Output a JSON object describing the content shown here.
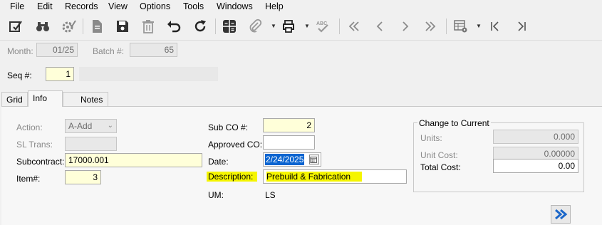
{
  "menu": [
    "File",
    "Edit",
    "Records",
    "View",
    "Options",
    "Tools",
    "Windows",
    "Help"
  ],
  "toolbar": {
    "icons": [
      "edit-check-icon",
      "binoculars-icon",
      "gear-check-icon",
      "document-icon",
      "save-icon",
      "delete-icon",
      "undo-icon",
      "refresh-icon",
      "calculator-icon",
      "attachment-icon",
      "print-icon",
      "spellcheck-icon",
      "first-record-icon",
      "previous-record-icon",
      "next-record-icon",
      "last-record-icon",
      "grid-settings-icon",
      "first-icon",
      "last-icon"
    ]
  },
  "header": {
    "month_label": "Month:",
    "month_value": "01/25",
    "batch_label": "Batch #:",
    "batch_value": "65",
    "seq_label": "Seq #:",
    "seq_value": "1",
    "seq_desc": ""
  },
  "tabs": [
    "Grid",
    "Info",
    "Notes"
  ],
  "info": {
    "action_label": "Action:",
    "action_value": "A-Add",
    "sltrans_label": "SL Trans:",
    "sltrans_value": "",
    "subcontract_label": "Subcontract:",
    "subcontract_value": "17000.001",
    "item_label": "Item#:",
    "item_value": "3",
    "subco_label": "Sub CO #:",
    "subco_value": "2",
    "approved_label": "Approved CO:",
    "approved_value": "",
    "date_label": "Date:",
    "date_value": "2/24/2025",
    "description_label": "Description:",
    "description_value": "Prebuild & Fabrication",
    "um_label": "UM:",
    "um_value": "LS"
  },
  "change_to_current": {
    "title": "Change to Current",
    "units_label": "Units:",
    "units_value": "0.000",
    "unitcost_label": "Unit Cost:",
    "unitcost_value": "0.00000",
    "totalcost_label": "Total Cost:",
    "totalcost_value": "0.00"
  },
  "colors": {
    "highlight": "#f5f500",
    "input_yellow": "#ffffd9",
    "nav_button": "#1a66c9"
  }
}
